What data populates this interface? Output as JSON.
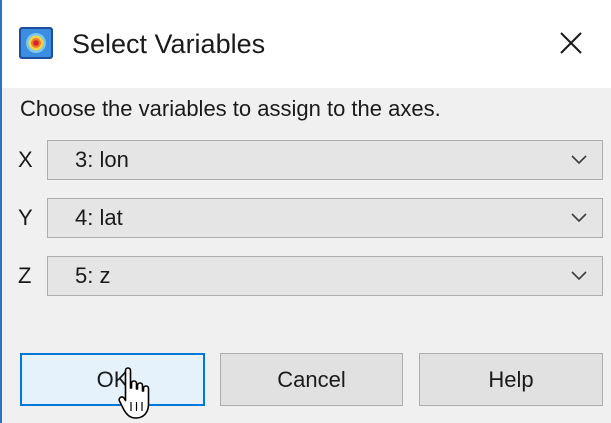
{
  "window": {
    "title": "Select Variables",
    "app_icon": "paraview-logo-icon",
    "close_icon": "close-icon"
  },
  "instructions": "Choose the variables to assign to the axes.",
  "axes": [
    {
      "label": "X",
      "selected": "3: lon"
    },
    {
      "label": "Y",
      "selected": "4: lat"
    },
    {
      "label": "Z",
      "selected": "5: z"
    }
  ],
  "buttons": {
    "ok": "OK",
    "cancel": "Cancel",
    "help": "Help"
  },
  "colors": {
    "accent": "#0078d7",
    "title_bar": "#ffffff",
    "dialog_bg": "#f0f0f0",
    "combo_bg": "#e5e5e5",
    "button_bg": "#e1e1e1",
    "focused_button_bg": "#e5f1fb"
  },
  "cursor_icon": "hand-pointer-cursor"
}
